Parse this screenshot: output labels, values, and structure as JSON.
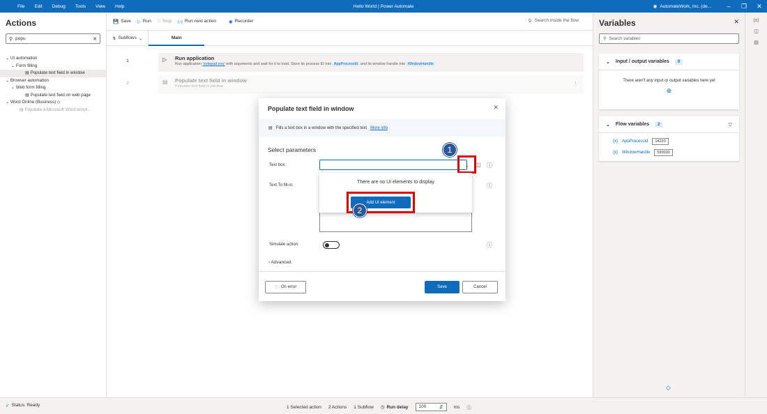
{
  "titlebar": {
    "menu": [
      "File",
      "Edit",
      "Debug",
      "Tools",
      "View",
      "Help"
    ],
    "title": "Hello World | Power Automate",
    "org": "AutomateWork, Inc. (de..."
  },
  "actions_panel": {
    "title": "Actions",
    "search_value": "popu",
    "tree": [
      {
        "label": "UI automation",
        "indent": 0,
        "chevron": "v"
      },
      {
        "label": "Form filling",
        "indent": 1,
        "chevron": "v"
      },
      {
        "label": "Populate text field in window",
        "indent": 2,
        "selected": true
      },
      {
        "label": "Browser automation",
        "indent": 0,
        "chevron": "v"
      },
      {
        "label": "Web form filling",
        "indent": 1,
        "chevron": "v"
      },
      {
        "label": "Populate text field on web page",
        "indent": 2
      },
      {
        "label": "Word Online (Business)",
        "indent": 0,
        "chevron": "v"
      },
      {
        "label": "Populate a Microsoft Word templ...",
        "indent": 1,
        "disabled": true
      }
    ]
  },
  "toolbar": {
    "save": "Save",
    "run": "Run",
    "stop": "Stop",
    "run_next": "Run next action",
    "recorder": "Recorder",
    "search": "Search inside the flow"
  },
  "subflows": {
    "label": "Subflows",
    "tab": "Main"
  },
  "steps": [
    {
      "number": "1",
      "title": "Run application",
      "d1": "Run application ",
      "app": "'notepad.exe'",
      "d2": " with arguments  and wait for it to load. Store its process ID into ",
      "var1": "AppProcessId",
      "d3": " and its window handle into ",
      "var2": "WindowHandle"
    },
    {
      "number": "2",
      "title": "Populate text field in window",
      "desc": "Populate text field in window"
    }
  ],
  "variables": {
    "title": "Variables",
    "search_placeholder": "Search variables",
    "io_title": "Input / output variables",
    "io_count": "0",
    "io_empty": "There aren't any input or output variables here yet",
    "flow_title": "Flow variables",
    "flow_count": "2",
    "flow_vars": [
      {
        "name": "AppProcessId",
        "value": "14220"
      },
      {
        "name": "WindowHandle",
        "value": "590030"
      }
    ]
  },
  "dialog": {
    "title": "Populate text field in window",
    "desc": "Fills a text box in a window with the specified text",
    "more_info": "More info",
    "section": "Select parameters",
    "textbox_label": "Text box:",
    "fillin_label": "Text To fill-in:",
    "no_elements": "There are no UI elements to display",
    "add_ui": "Add UI element",
    "simulate_label": "Simulate action:",
    "advanced": "Advanced",
    "on_error": "On error",
    "save": "Save",
    "cancel": "Cancel",
    "callout1": "1",
    "callout2": "2"
  },
  "statusbar": {
    "status": "Status: Ready",
    "selected": "1 Selected action",
    "actions": "2 Actions",
    "subflow": "1 Subflow",
    "run_delay_label": "Run delay",
    "run_delay_value": "100",
    "unit": "ms"
  }
}
